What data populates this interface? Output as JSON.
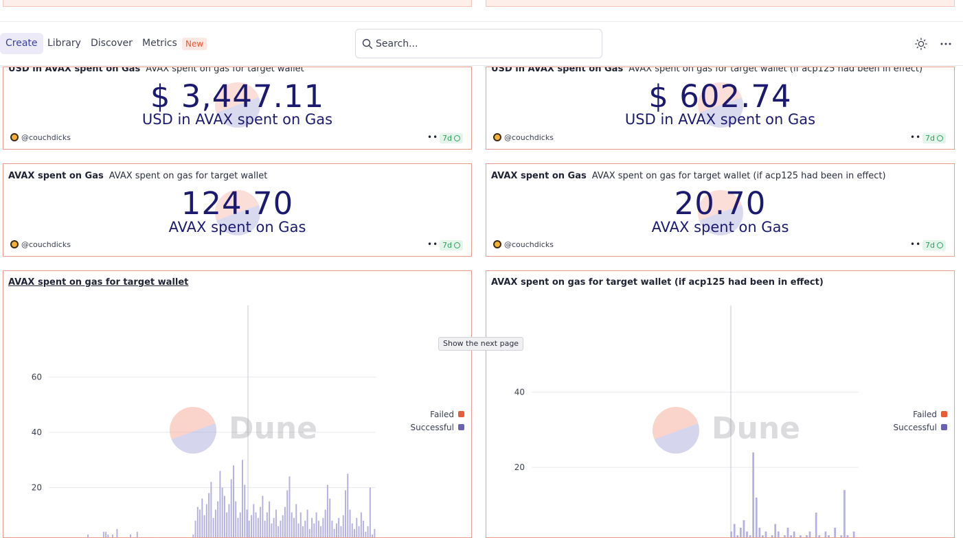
{
  "nav": {
    "items": [
      "Create",
      "Library",
      "Discover",
      "Metrics"
    ],
    "new_badge": "New",
    "search_placeholder": "Search..."
  },
  "counters": [
    {
      "title": "USD in AVAX spent on Gas",
      "subtitle": "AVAX spent on gas for target wallet",
      "value": "$ 3,447.11",
      "label": "USD in AVAX spent on Gas",
      "author": "@couchdicks",
      "freshness": "7d"
    },
    {
      "title": "USD in AVAX spent on Gas",
      "subtitle": "AVAX spent on gas for target wallet (if acp125 had been in effect)",
      "value": "$ 602.74",
      "label": "USD in AVAX spent on Gas",
      "author": "@couchdicks",
      "freshness": "7d"
    },
    {
      "title": "AVAX spent on Gas",
      "subtitle": "AVAX spent on gas for target wallet",
      "value": "124.70",
      "label": "AVAX spent on Gas",
      "author": "@couchdicks",
      "freshness": "7d"
    },
    {
      "title": "AVAX spent on Gas",
      "subtitle": "AVAX spent on gas for target wallet (if acp125 had been in effect)",
      "value": "20.70",
      "label": "AVAX spent on Gas",
      "author": "@couchdicks",
      "freshness": "7d"
    }
  ],
  "charts": {
    "left_title": "AVAX spent on gas for target wallet",
    "right_title": "AVAX spent on gas for target wallet (if acp125 had been in effect)",
    "legend": [
      "Failed",
      "Successful"
    ],
    "watermark": "Dune",
    "tooltip": "Show the next page"
  },
  "colors": {
    "failed": "#e85c3a",
    "successful": "#6a63b5",
    "accent": "#1c1a6e"
  },
  "chart_data": [
    {
      "type": "bar",
      "title": "AVAX spent on gas for target wallet",
      "y_ticks": [
        20,
        40,
        60
      ],
      "ylim": [
        0,
        75
      ],
      "legend": [
        "Failed",
        "Successful"
      ],
      "legend_position": "right",
      "series": [
        {
          "name": "Successful",
          "values": [
            1,
            1,
            1,
            0,
            0,
            1,
            1,
            0,
            0,
            0,
            0,
            1,
            1,
            1,
            0,
            0,
            2,
            3,
            0,
            0,
            0,
            0,
            0,
            0,
            4,
            4,
            3,
            2,
            3,
            2,
            5,
            1,
            2,
            2,
            1,
            0,
            3,
            2,
            1,
            4,
            0,
            0,
            0,
            0,
            0,
            0,
            0,
            1,
            2,
            1,
            0,
            0,
            0,
            0,
            0,
            0,
            0,
            0,
            0,
            0,
            0,
            0,
            0,
            1,
            3,
            8,
            13,
            12,
            16,
            10,
            14,
            18,
            22,
            9,
            12,
            15,
            26,
            20,
            17,
            11,
            14,
            23,
            28,
            15,
            9,
            11,
            30,
            21,
            12,
            8,
            10,
            14,
            11,
            9,
            13,
            17,
            8,
            11,
            15,
            7,
            9,
            12,
            6,
            8,
            10,
            13,
            19,
            24,
            11,
            9,
            14,
            7,
            11,
            6,
            8,
            12,
            5,
            9,
            7,
            11,
            8,
            6,
            9,
            12,
            21,
            16,
            8,
            5,
            7,
            9,
            6,
            10,
            19,
            25,
            12,
            7,
            5,
            9,
            6,
            11,
            8,
            4,
            6,
            20,
            3,
            5
          ]
        },
        {
          "name": "Failed",
          "values": [
            0,
            0,
            0,
            0,
            0,
            0,
            0,
            0,
            0,
            0
          ]
        }
      ]
    },
    {
      "type": "bar",
      "title": "AVAX spent on gas for target wallet (if acp125 had been in effect)",
      "y_ticks": [
        20,
        40
      ],
      "ylim": [
        0,
        55
      ],
      "legend": [
        "Failed",
        "Successful"
      ],
      "legend_position": "right",
      "series": [
        {
          "name": "Successful",
          "values": [
            0,
            0,
            0,
            0,
            0,
            0,
            0,
            0,
            0,
            0,
            0,
            0,
            0,
            0,
            0,
            0,
            0,
            0,
            0,
            0,
            0,
            0,
            0,
            0,
            0,
            0,
            0,
            0,
            0,
            0,
            0,
            0,
            0,
            0,
            0,
            0,
            0,
            0,
            0,
            0,
            0,
            0,
            0,
            0,
            0,
            0,
            0,
            0,
            0,
            0,
            0,
            0,
            0,
            0,
            0,
            0,
            0,
            0,
            0,
            0,
            0,
            0,
            0,
            3,
            5,
            2,
            4,
            6,
            3,
            2,
            24,
            12,
            4,
            2,
            3,
            1,
            2,
            5,
            3,
            1,
            2,
            4,
            2,
            3,
            1,
            2,
            1,
            2,
            3,
            1,
            8,
            2,
            1,
            3,
            2,
            1,
            4,
            1,
            2,
            14,
            2,
            1,
            3,
            1
          ]
        },
        {
          "name": "Failed",
          "values": [
            0,
            0,
            0,
            0
          ]
        }
      ]
    }
  ]
}
